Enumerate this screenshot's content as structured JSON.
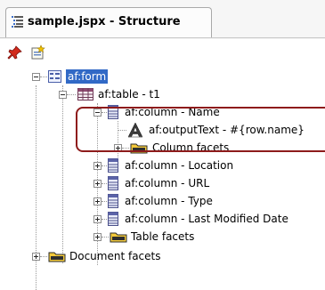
{
  "window": {
    "title": "sample.jspx - Structure"
  },
  "tree": {
    "items": [
      {
        "label": "af:form"
      },
      {
        "label": "af:table - t1"
      },
      {
        "label": "af:column - Name"
      },
      {
        "label": "af:outputText - #{row.name}"
      },
      {
        "label": "Column facets"
      },
      {
        "label": "af:column - Location"
      },
      {
        "label": "af:column - URL"
      },
      {
        "label": "af:column - Type"
      },
      {
        "label": "af:column - Last Modified Date"
      },
      {
        "label": "Table facets"
      },
      {
        "label": "Document facets"
      }
    ]
  },
  "colors": {
    "selection": "#3169c6",
    "highlight_border": "#8e1b1b"
  }
}
